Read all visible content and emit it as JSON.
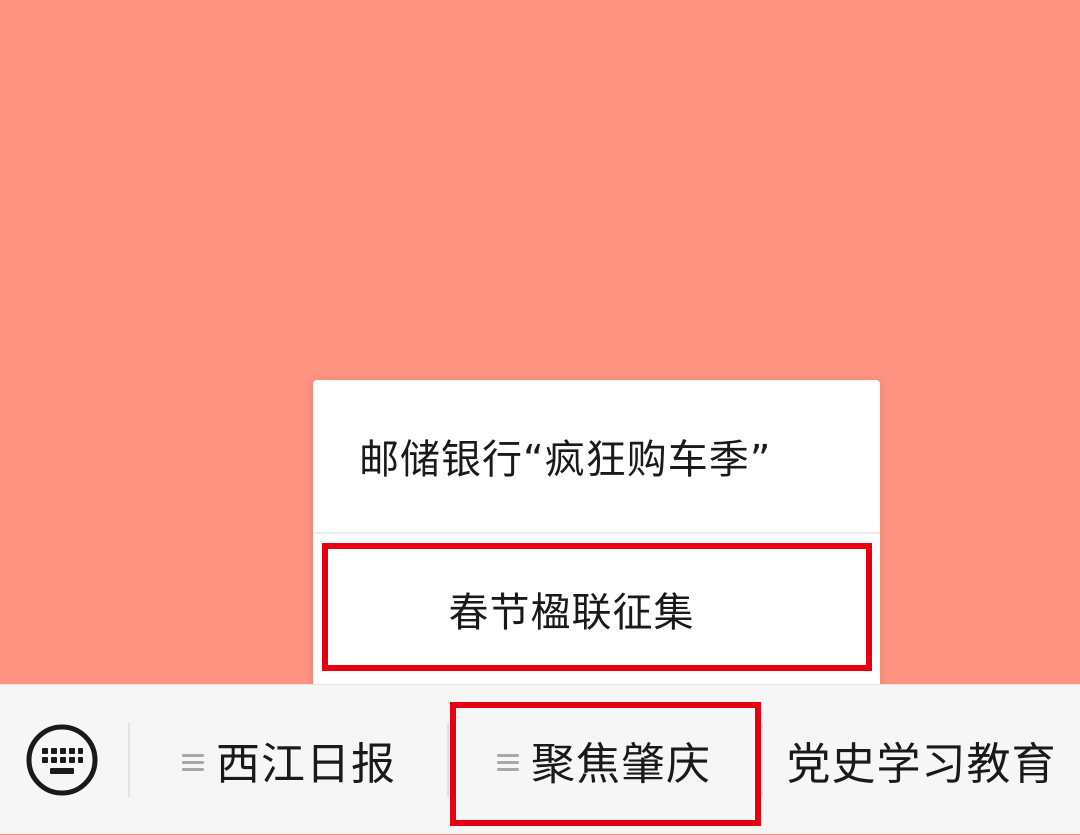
{
  "popup": {
    "items": [
      {
        "label": "邮储银行“疯狂购车季”"
      },
      {
        "label": "春节楹联征集"
      }
    ]
  },
  "bottom_menu": {
    "keyboard_icon": "keyboard-icon",
    "menu_icon": "menu-lines-icon",
    "items": [
      {
        "label": "西江日报"
      },
      {
        "label": "聚焦肇庆"
      },
      {
        "label": "党史学习教育"
      }
    ]
  },
  "colors": {
    "background": "#ff9382",
    "highlight": "#e60012",
    "bar_background": "#f6f6f6",
    "text": "#1a1a1a"
  }
}
